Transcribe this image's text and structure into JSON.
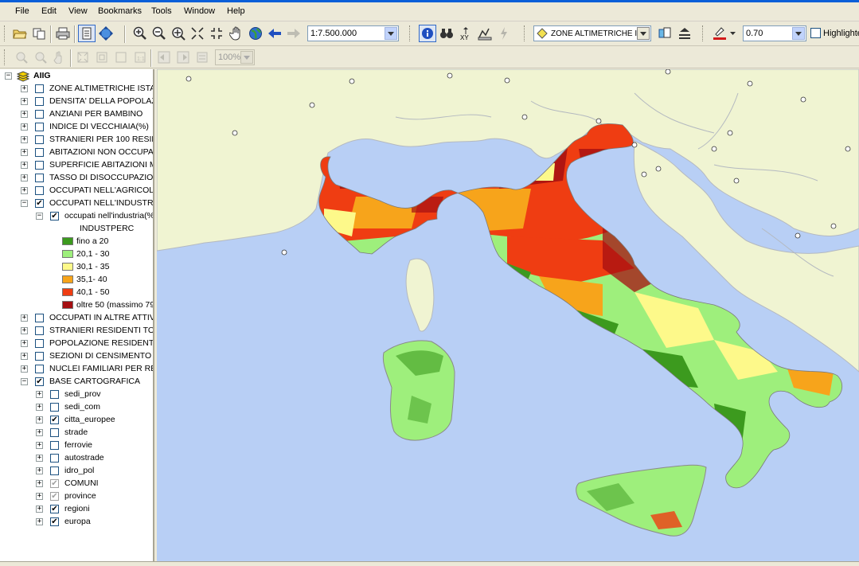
{
  "menu": [
    "File",
    "Edit",
    "View",
    "Bookmarks",
    "Tools",
    "Window",
    "Help"
  ],
  "toolbar": {
    "scale": "1:7.500.000",
    "layer_selector": "ZONE ALTIMETRICHE I",
    "transparency": "0.70",
    "highlight_label": "Highlighte",
    "zoom_percent": "100%"
  },
  "toc": {
    "root": "AIIG",
    "layers_top": [
      {
        "label": "ZONE ALTIMETRICHE ISTA",
        "checked": false
      },
      {
        "label": "DENSITA' DELLA POPOLAZ",
        "checked": false
      },
      {
        "label": "ANZIANI PER BAMBINO",
        "checked": false
      },
      {
        "label": "INDICE DI VECCHIAIA(%)",
        "checked": false
      },
      {
        "label": "STRANIERI PER 100 RESID",
        "checked": false
      },
      {
        "label": "ABITAZIONI NON OCCUPA",
        "checked": false
      },
      {
        "label": "SUPERFICIE ABITAZIONI M",
        "checked": false
      },
      {
        "label": "TASSO DI DISOCCUPAZIO",
        "checked": false
      },
      {
        "label": "OCCUPATI NELL'AGRICOLT",
        "checked": false
      },
      {
        "label": "OCCUPATI NELL'INDUSTRI",
        "checked": true
      }
    ],
    "sublayer": "occupati nell'industria(%",
    "field": "INDUSTPERC",
    "legend": [
      {
        "label": "fino a 20",
        "color": "#3c9a1e"
      },
      {
        "label": "20,1 - 30",
        "color": "#9eef7c"
      },
      {
        "label": "30,1 - 35",
        "color": "#fdf98a"
      },
      {
        "label": "35,1- 40",
        "color": "#f7a41b"
      },
      {
        "label": "40,1 - 50",
        "color": "#ef3d12"
      },
      {
        "label": "oltre 50 (massimo 79",
        "color": "#a50f12"
      }
    ],
    "layers_bottom": [
      {
        "label": "OCCUPATI IN ALTRE ATTIV",
        "checked": false
      },
      {
        "label": "STRANIERI RESIDENTI TO",
        "checked": false
      },
      {
        "label": "POPOLAZIONE RESIDENTE",
        "checked": false
      },
      {
        "label": "SEZIONI DI CENSIMENTO I",
        "checked": false
      },
      {
        "label": "NUCLEI FAMILIARI PER RE",
        "checked": false
      },
      {
        "label": "BASE CARTOGRAFICA",
        "checked": true
      }
    ],
    "base_layers": [
      {
        "label": "sedi_prov",
        "state": "unchecked"
      },
      {
        "label": "sedi_com",
        "state": "unchecked"
      },
      {
        "label": "citta_europee",
        "state": "checked"
      },
      {
        "label": "strade",
        "state": "unchecked"
      },
      {
        "label": "ferrovie",
        "state": "unchecked"
      },
      {
        "label": "autostrade",
        "state": "unchecked"
      },
      {
        "label": "idro_pol",
        "state": "unchecked"
      },
      {
        "label": "COMUNI",
        "state": "grey"
      },
      {
        "label": "province",
        "state": "grey"
      },
      {
        "label": "regioni",
        "state": "checked"
      },
      {
        "label": "europa",
        "state": "checked"
      }
    ]
  },
  "map": {
    "sea_color": "#b8cff5",
    "land_color": "#f0f4d2",
    "border_color": "#b4b9c0"
  }
}
